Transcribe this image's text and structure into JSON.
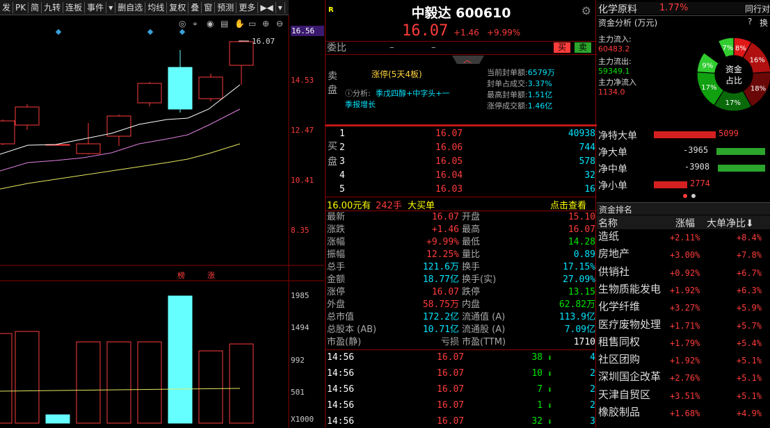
{
  "toolbar": {
    "items": [
      "发",
      "PK",
      "简",
      "九转",
      "连板",
      "事件",
      "▾",
      "删自选",
      "均线",
      "复权",
      "叠",
      "窗",
      "预测",
      "更多",
      "▶◀",
      "▾"
    ]
  },
  "chart": {
    "price_labels": [
      "16.56",
      "14.53",
      "12.47",
      "10.41",
      "8.35"
    ],
    "current_price_marker": "16.07",
    "volume_labels": [
      "1985",
      "1494",
      "992",
      "501",
      "X1000"
    ],
    "tags": [
      "榜",
      "涨"
    ]
  },
  "stock": {
    "name": "中毅达",
    "code": "600610",
    "price": "16.07",
    "change": "+1.46",
    "change_pct": "+9.99%",
    "r_badge": "R",
    "weibi_label": "委比",
    "weibi_dash1": "–",
    "weibi_dash2": "–",
    "buy_btn": "买",
    "sell_btn": "卖",
    "sell_side": "卖盘",
    "buy_side": "买盘",
    "limit_text": "涨停(5天4板)",
    "analysis_label": "ⓘ分析:",
    "analysis_text": "季戊四醇+中字头+一",
    "analysis_text2": "季报增长",
    "seal_info": [
      {
        "k": "当前封单额:",
        "v": "6579万"
      },
      {
        "k": "封单占成交:",
        "v": "3.37%"
      },
      {
        "k": "最高封单额:",
        "v": "1.51亿"
      },
      {
        "k": "涨停成交额:",
        "v": "1.46亿"
      }
    ],
    "bids": [
      {
        "n": "1",
        "p": "16.07",
        "v": "40938"
      },
      {
        "n": "2",
        "p": "16.06",
        "v": "744"
      },
      {
        "n": "3",
        "p": "16.05",
        "v": "578"
      },
      {
        "n": "4",
        "p": "16.04",
        "v": "32"
      },
      {
        "n": "5",
        "p": "16.03",
        "v": "16"
      }
    ],
    "big_order": {
      "price": "16.00元有",
      "qty": "242手",
      "label": "大买单",
      "link": "点击查看"
    },
    "quote_left": [
      {
        "k": "最新",
        "v": "16.07"
      },
      {
        "k": "涨跌",
        "v": "+1.46"
      },
      {
        "k": "涨幅",
        "v": "+9.99%"
      },
      {
        "k": "振幅",
        "v": "12.25%"
      },
      {
        "k": "总手",
        "v": "121.6万"
      },
      {
        "k": "金额",
        "v": "18.77亿"
      },
      {
        "k": "涨停",
        "v": "16.07"
      },
      {
        "k": "外盘",
        "v": "58.75万"
      },
      {
        "k": "总市值",
        "v": "172.2亿"
      },
      {
        "k": "总股本 (AB)",
        "v": "10.71亿"
      },
      {
        "k": "市盈(静)",
        "v": "亏损"
      }
    ],
    "quote_right": [
      {
        "k": "开盘",
        "v": "15.10"
      },
      {
        "k": "最高",
        "v": "16.07"
      },
      {
        "k": "最低",
        "v": "14.28"
      },
      {
        "k": "量比",
        "v": "0.89"
      },
      {
        "k": "换手",
        "v": "17.15%"
      },
      {
        "k": "换手(实)",
        "v": "27.09%"
      },
      {
        "k": "跌停",
        "v": "13.15"
      },
      {
        "k": "内盘",
        "v": "62.82万"
      },
      {
        "k": "流通值 (A)",
        "v": "113.9亿"
      },
      {
        "k": "流通股 (A)",
        "v": "7.09亿"
      },
      {
        "k": "市盈(TTM)",
        "v": "1710"
      }
    ],
    "ticks": [
      {
        "t": "14:56",
        "p": "16.07",
        "v": "38",
        "s": "4"
      },
      {
        "t": "14:56",
        "p": "16.07",
        "v": "10",
        "s": "2"
      },
      {
        "t": "14:56",
        "p": "16.07",
        "v": "7",
        "s": "2"
      },
      {
        "t": "14:56",
        "p": "16.07",
        "v": "1",
        "s": "2"
      },
      {
        "t": "14:56",
        "p": "16.07",
        "v": "32",
        "s": "3"
      }
    ]
  },
  "right": {
    "sector": "化学原料",
    "sector_pct": "1.77%",
    "sector_link": "同行对",
    "fund_title": "资金分析 (万元)",
    "help": "?",
    "tab": "换",
    "inflow_label": "主力流入:",
    "inflow": "60483.2",
    "outflow_label": "主力流出:",
    "outflow": "59349.1",
    "net_label": "主力净流入",
    "net": "1134.0",
    "donut_center": "资金\n占比",
    "donut_center1": "资金",
    "donut_center2": "占比",
    "slices": [
      "7%",
      "8%",
      "16%",
      "18%",
      "17%",
      "17%",
      "9%"
    ],
    "nets": [
      {
        "k": "净特大单",
        "v": "5099",
        "frac": 0.74,
        "color": "#d42020"
      },
      {
        "k": "净大单",
        "v": "-3965",
        "frac": 0.58,
        "color": "#2ba52b"
      },
      {
        "k": "净中单",
        "v": "-3908",
        "frac": 0.57,
        "color": "#2ba52b"
      },
      {
        "k": "净小单",
        "v": "2774",
        "frac": 0.4,
        "color": "#d42020"
      }
    ],
    "rank_title": "资金排名",
    "rank_headers": [
      "名称",
      "涨幅",
      "大单净比⬇"
    ],
    "ranks": [
      {
        "n": "造纸",
        "c": "+2.11%",
        "r": "+8.4%"
      },
      {
        "n": "房地产",
        "c": "+3.00%",
        "r": "+7.8%"
      },
      {
        "n": "供销社",
        "c": "+0.92%",
        "r": "+6.7%"
      },
      {
        "n": "生物质能发电",
        "c": "+1.92%",
        "r": "+6.3%"
      },
      {
        "n": "化学纤维",
        "c": "+3.27%",
        "r": "+5.9%"
      },
      {
        "n": "医疗废物处理",
        "c": "+1.71%",
        "r": "+5.7%"
      },
      {
        "n": "租售同权",
        "c": "+1.79%",
        "r": "+5.4%"
      },
      {
        "n": "社区团购",
        "c": "+1.92%",
        "r": "+5.1%"
      },
      {
        "n": "深圳国企改革",
        "c": "+2.76%",
        "r": "+5.1%"
      },
      {
        "n": "天津自贸区",
        "c": "+3.51%",
        "r": "+5.1%"
      },
      {
        "n": "橡胶制品",
        "c": "+1.68%",
        "r": "+4.9%"
      }
    ],
    "colors": {
      "up": "#ff3c3c",
      "down": "#00e600",
      "panel_border": "#8a0000"
    }
  }
}
